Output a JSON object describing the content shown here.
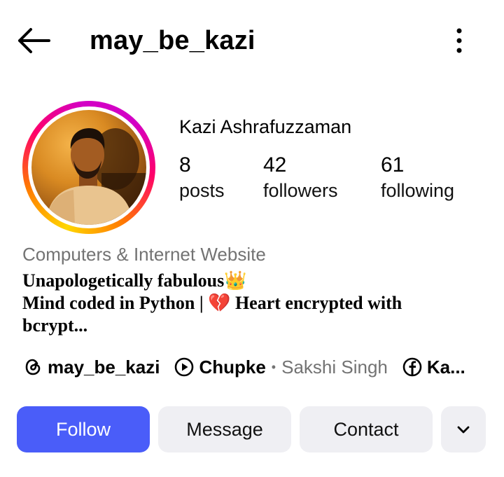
{
  "header": {
    "username": "may_be_kazi",
    "back_icon": "arrow-left-icon",
    "more_icon": "more-vertical-icon"
  },
  "profile": {
    "full_name": "Kazi Ashrafuzzaman",
    "stats": [
      {
        "value": "8",
        "label": "posts"
      },
      {
        "value": "42",
        "label": "followers"
      },
      {
        "value": "61",
        "label": "following"
      }
    ],
    "category": "Computers & Internet Website",
    "bio_line1": "Unapologetically fabulous",
    "bio_emoji1": "👑",
    "bio_line2a": "Mind coded in Python  |",
    "bio_emoji2": "💔",
    "bio_line2b": "Heart encrypted with",
    "bio_line3": "bcrypt..."
  },
  "links": {
    "threads_handle": "may_be_kazi",
    "music_title": "Chupke",
    "music_separator": "•",
    "music_artist": "Sakshi Singh",
    "facebook_text": "Ka..."
  },
  "actions": {
    "follow": "Follow",
    "message": "Message",
    "contact": "Contact"
  },
  "colors": {
    "follow_button": "#4a5df9",
    "secondary_button": "#efeff3",
    "muted_text": "#737373"
  }
}
